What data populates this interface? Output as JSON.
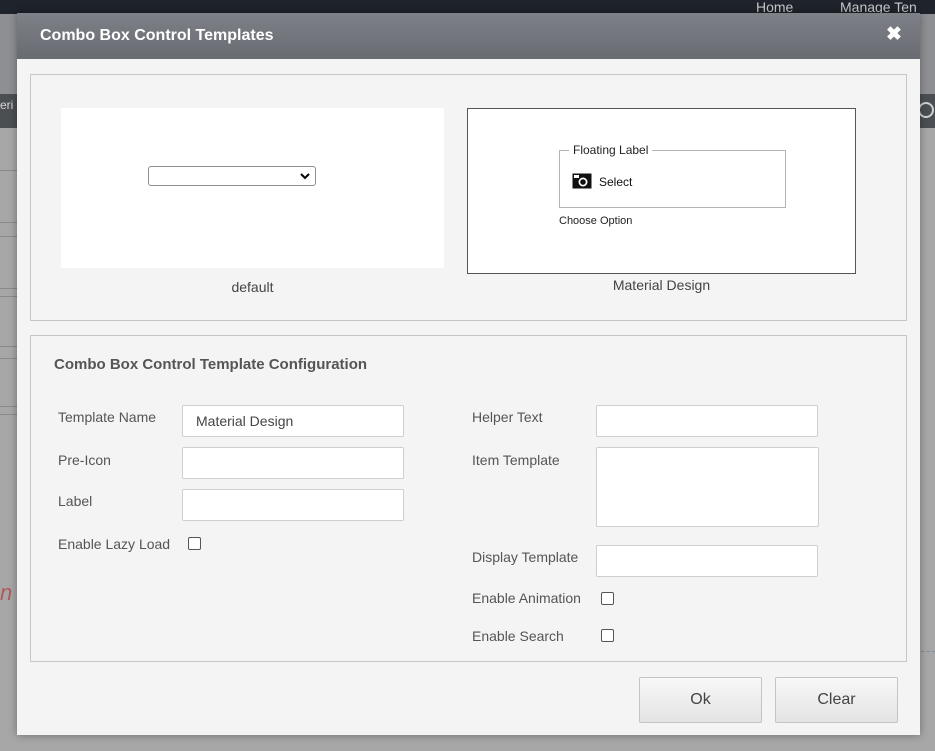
{
  "background": {
    "nav": [
      "Home",
      "Manage Ten"
    ],
    "sidebar_fragment": "eri",
    "red_fragment": "n"
  },
  "modal": {
    "title": "Combo Box Control Templates",
    "close_icon": "close-x-icon"
  },
  "templates": [
    {
      "caption": "default"
    },
    {
      "caption": "Material Design",
      "floating_label": "Floating Label",
      "pre_icon": "camera-icon",
      "select_text": "Select",
      "helper_text": "Choose Option"
    }
  ],
  "config": {
    "heading": "Combo Box Control Template Configuration",
    "template_name": {
      "label": "Template Name",
      "value": "Material Design"
    },
    "pre_icon": {
      "label": "Pre-Icon",
      "value": ""
    },
    "label": {
      "label": "Label",
      "value": ""
    },
    "enable_lazy_load": {
      "label": "Enable Lazy Load",
      "checked": false
    },
    "helper_text": {
      "label": "Helper Text",
      "value": ""
    },
    "item_template": {
      "label": "Item Template",
      "value": ""
    },
    "display_template": {
      "label": "Display Template",
      "value": ""
    },
    "enable_animation": {
      "label": "Enable Animation",
      "checked": false
    },
    "enable_search": {
      "label": "Enable Search",
      "checked": false
    }
  },
  "buttons": {
    "ok": "Ok",
    "clear": "Clear"
  }
}
